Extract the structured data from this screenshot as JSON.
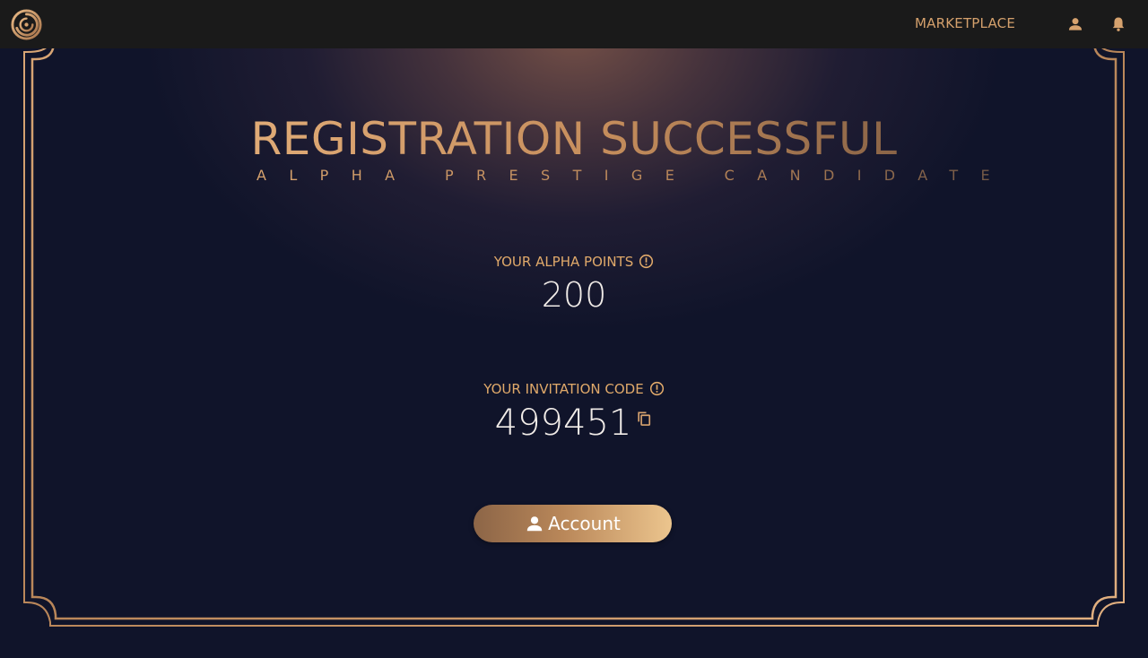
{
  "topbar": {
    "logo_icon": "spiral-logo-icon",
    "marketplace_label": "MARKETPLACE",
    "profile_icon": "user-icon",
    "notifications_icon": "bell-icon"
  },
  "main": {
    "title": "REGISTRATION SUCCESSFUL",
    "subtitle": "ALPHA PRESTIGE CANDIDATE",
    "points_label": "YOUR ALPHA POINTS",
    "points_value": "200",
    "invitation_label": "YOUR INVITATION CODE",
    "invitation_code": "499451",
    "account_button_label": "Account"
  },
  "colors": {
    "accent_gold": "#d4a06c",
    "background_navy": "#10142a",
    "topbar": "#1a1a1a"
  }
}
